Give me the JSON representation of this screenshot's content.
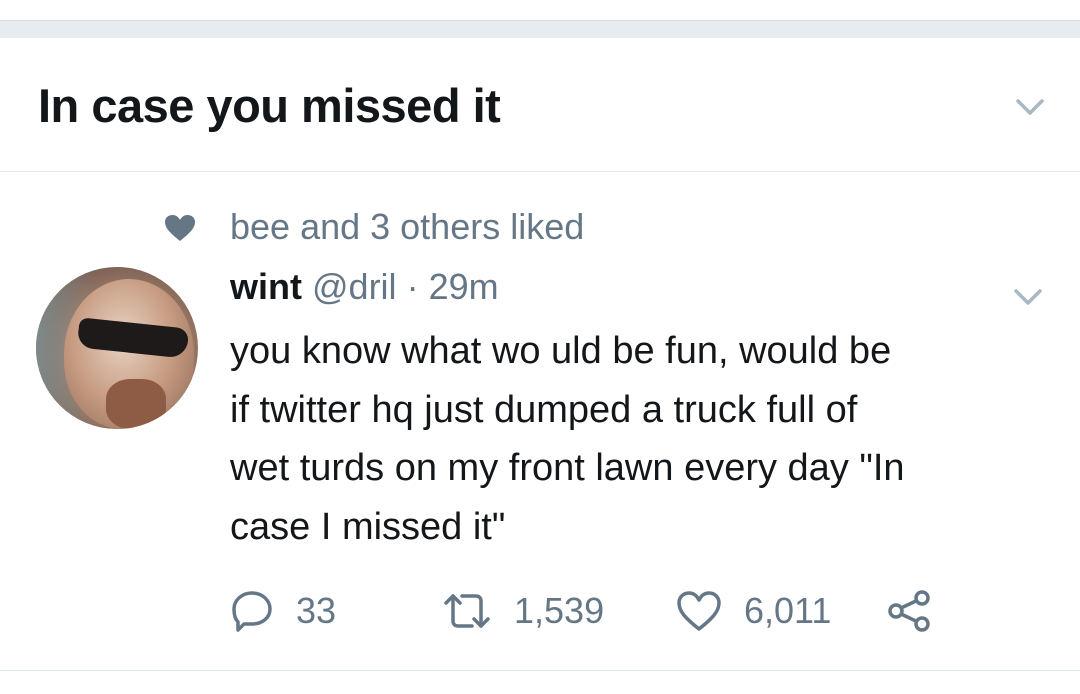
{
  "section": {
    "title": "In case you missed it",
    "chevron_icon": "chevron-down-icon"
  },
  "tweet": {
    "social_context": {
      "icon": "heart-filled-icon",
      "text": "bee and 3 others liked"
    },
    "author": {
      "name": "wint",
      "handle": "@dril",
      "separator": "·",
      "time": "29m"
    },
    "text_lines": [
      "you know what wo uld be fun, would be",
      "if twitter hq just dumped a truck full of",
      "wet turds on my front lawn every day \"In",
      "case I missed it\""
    ],
    "actions": {
      "reply": {
        "icon": "reply-icon",
        "count": "33"
      },
      "retweet": {
        "icon": "retweet-icon",
        "count": "1,539"
      },
      "like": {
        "icon": "heart-outline-icon",
        "count": "6,011"
      },
      "share": {
        "icon": "share-icon"
      }
    }
  },
  "colors": {
    "text_primary": "#14171a",
    "text_secondary": "#657786",
    "divider": "#e1e8ed",
    "background_gap": "#e6ecf0",
    "icon_gray": "#657786",
    "chevron_gray": "#aab8c2"
  }
}
